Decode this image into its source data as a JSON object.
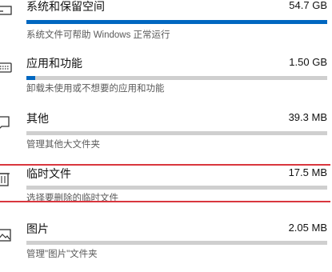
{
  "accent_color": "#0067c0",
  "highlight_color": "#d9363e",
  "items": [
    {
      "icon": "hard-drive-icon",
      "title": "系统和保留空间",
      "size": "54.7 GB",
      "desc": "系统文件可帮助 Windows 正常运行",
      "usage_percent": 100
    },
    {
      "icon": "keyboard-apps-icon",
      "title": "应用和功能",
      "size": "1.50 GB",
      "desc": "卸载未使用或不想要的应用和功能",
      "usage_percent": 3
    },
    {
      "icon": "other-files-icon",
      "title": "其他",
      "size": "39.3 MB",
      "desc": "管理其他大文件夹",
      "usage_percent": 0
    },
    {
      "icon": "trash-icon",
      "title": "临时文件",
      "size": "17.5 MB",
      "desc": "选择要删除的临时文件",
      "usage_percent": 0
    },
    {
      "icon": "pictures-icon",
      "title": "图片",
      "size": "2.05 MB",
      "desc": "管理\"图片\"文件夹",
      "usage_percent": 0
    }
  ]
}
